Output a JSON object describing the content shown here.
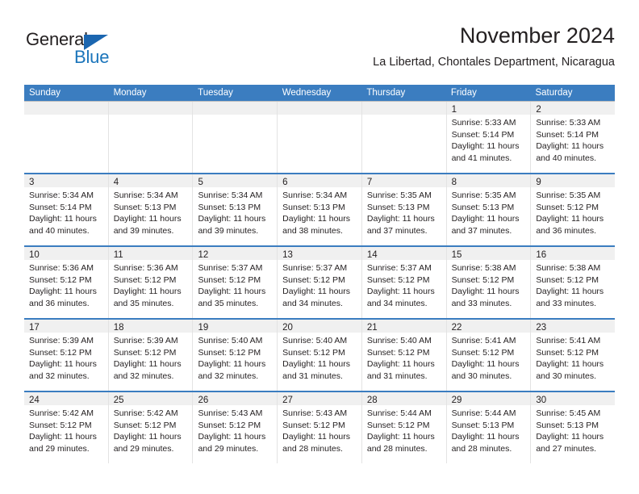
{
  "logo": {
    "word1": "General",
    "word2": "Blue",
    "triangle_color": "#1b66b0",
    "blue_color": "#1b75bb"
  },
  "header": {
    "title": "November 2024",
    "subtitle": "La Libertad, Chontales Department, Nicaragua"
  },
  "theme": {
    "header_blue": "#3b7dc0",
    "daynum_band": "#f0f0f0",
    "text": "#231f20"
  },
  "weekday_headers": [
    "Sunday",
    "Monday",
    "Tuesday",
    "Wednesday",
    "Thursday",
    "Friday",
    "Saturday"
  ],
  "weeks": [
    {
      "days": [
        {
          "num": "",
          "sunrise": "",
          "sunset": "",
          "daylight1": "",
          "daylight2": "",
          "empty": true
        },
        {
          "num": "",
          "sunrise": "",
          "sunset": "",
          "daylight1": "",
          "daylight2": "",
          "empty": true
        },
        {
          "num": "",
          "sunrise": "",
          "sunset": "",
          "daylight1": "",
          "daylight2": "",
          "empty": true
        },
        {
          "num": "",
          "sunrise": "",
          "sunset": "",
          "daylight1": "",
          "daylight2": "",
          "empty": true
        },
        {
          "num": "",
          "sunrise": "",
          "sunset": "",
          "daylight1": "",
          "daylight2": "",
          "empty": true
        },
        {
          "num": "1",
          "sunrise": "Sunrise: 5:33 AM",
          "sunset": "Sunset: 5:14 PM",
          "daylight1": "Daylight: 11 hours",
          "daylight2": "and 41 minutes."
        },
        {
          "num": "2",
          "sunrise": "Sunrise: 5:33 AM",
          "sunset": "Sunset: 5:14 PM",
          "daylight1": "Daylight: 11 hours",
          "daylight2": "and 40 minutes."
        }
      ]
    },
    {
      "days": [
        {
          "num": "3",
          "sunrise": "Sunrise: 5:34 AM",
          "sunset": "Sunset: 5:14 PM",
          "daylight1": "Daylight: 11 hours",
          "daylight2": "and 40 minutes."
        },
        {
          "num": "4",
          "sunrise": "Sunrise: 5:34 AM",
          "sunset": "Sunset: 5:13 PM",
          "daylight1": "Daylight: 11 hours",
          "daylight2": "and 39 minutes."
        },
        {
          "num": "5",
          "sunrise": "Sunrise: 5:34 AM",
          "sunset": "Sunset: 5:13 PM",
          "daylight1": "Daylight: 11 hours",
          "daylight2": "and 39 minutes."
        },
        {
          "num": "6",
          "sunrise": "Sunrise: 5:34 AM",
          "sunset": "Sunset: 5:13 PM",
          "daylight1": "Daylight: 11 hours",
          "daylight2": "and 38 minutes."
        },
        {
          "num": "7",
          "sunrise": "Sunrise: 5:35 AM",
          "sunset": "Sunset: 5:13 PM",
          "daylight1": "Daylight: 11 hours",
          "daylight2": "and 37 minutes."
        },
        {
          "num": "8",
          "sunrise": "Sunrise: 5:35 AM",
          "sunset": "Sunset: 5:13 PM",
          "daylight1": "Daylight: 11 hours",
          "daylight2": "and 37 minutes."
        },
        {
          "num": "9",
          "sunrise": "Sunrise: 5:35 AM",
          "sunset": "Sunset: 5:12 PM",
          "daylight1": "Daylight: 11 hours",
          "daylight2": "and 36 minutes."
        }
      ]
    },
    {
      "days": [
        {
          "num": "10",
          "sunrise": "Sunrise: 5:36 AM",
          "sunset": "Sunset: 5:12 PM",
          "daylight1": "Daylight: 11 hours",
          "daylight2": "and 36 minutes."
        },
        {
          "num": "11",
          "sunrise": "Sunrise: 5:36 AM",
          "sunset": "Sunset: 5:12 PM",
          "daylight1": "Daylight: 11 hours",
          "daylight2": "and 35 minutes."
        },
        {
          "num": "12",
          "sunrise": "Sunrise: 5:37 AM",
          "sunset": "Sunset: 5:12 PM",
          "daylight1": "Daylight: 11 hours",
          "daylight2": "and 35 minutes."
        },
        {
          "num": "13",
          "sunrise": "Sunrise: 5:37 AM",
          "sunset": "Sunset: 5:12 PM",
          "daylight1": "Daylight: 11 hours",
          "daylight2": "and 34 minutes."
        },
        {
          "num": "14",
          "sunrise": "Sunrise: 5:37 AM",
          "sunset": "Sunset: 5:12 PM",
          "daylight1": "Daylight: 11 hours",
          "daylight2": "and 34 minutes."
        },
        {
          "num": "15",
          "sunrise": "Sunrise: 5:38 AM",
          "sunset": "Sunset: 5:12 PM",
          "daylight1": "Daylight: 11 hours",
          "daylight2": "and 33 minutes."
        },
        {
          "num": "16",
          "sunrise": "Sunrise: 5:38 AM",
          "sunset": "Sunset: 5:12 PM",
          "daylight1": "Daylight: 11 hours",
          "daylight2": "and 33 minutes."
        }
      ]
    },
    {
      "days": [
        {
          "num": "17",
          "sunrise": "Sunrise: 5:39 AM",
          "sunset": "Sunset: 5:12 PM",
          "daylight1": "Daylight: 11 hours",
          "daylight2": "and 32 minutes."
        },
        {
          "num": "18",
          "sunrise": "Sunrise: 5:39 AM",
          "sunset": "Sunset: 5:12 PM",
          "daylight1": "Daylight: 11 hours",
          "daylight2": "and 32 minutes."
        },
        {
          "num": "19",
          "sunrise": "Sunrise: 5:40 AM",
          "sunset": "Sunset: 5:12 PM",
          "daylight1": "Daylight: 11 hours",
          "daylight2": "and 32 minutes."
        },
        {
          "num": "20",
          "sunrise": "Sunrise: 5:40 AM",
          "sunset": "Sunset: 5:12 PM",
          "daylight1": "Daylight: 11 hours",
          "daylight2": "and 31 minutes."
        },
        {
          "num": "21",
          "sunrise": "Sunrise: 5:40 AM",
          "sunset": "Sunset: 5:12 PM",
          "daylight1": "Daylight: 11 hours",
          "daylight2": "and 31 minutes."
        },
        {
          "num": "22",
          "sunrise": "Sunrise: 5:41 AM",
          "sunset": "Sunset: 5:12 PM",
          "daylight1": "Daylight: 11 hours",
          "daylight2": "and 30 minutes."
        },
        {
          "num": "23",
          "sunrise": "Sunrise: 5:41 AM",
          "sunset": "Sunset: 5:12 PM",
          "daylight1": "Daylight: 11 hours",
          "daylight2": "and 30 minutes."
        }
      ]
    },
    {
      "days": [
        {
          "num": "24",
          "sunrise": "Sunrise: 5:42 AM",
          "sunset": "Sunset: 5:12 PM",
          "daylight1": "Daylight: 11 hours",
          "daylight2": "and 29 minutes."
        },
        {
          "num": "25",
          "sunrise": "Sunrise: 5:42 AM",
          "sunset": "Sunset: 5:12 PM",
          "daylight1": "Daylight: 11 hours",
          "daylight2": "and 29 minutes."
        },
        {
          "num": "26",
          "sunrise": "Sunrise: 5:43 AM",
          "sunset": "Sunset: 5:12 PM",
          "daylight1": "Daylight: 11 hours",
          "daylight2": "and 29 minutes."
        },
        {
          "num": "27",
          "sunrise": "Sunrise: 5:43 AM",
          "sunset": "Sunset: 5:12 PM",
          "daylight1": "Daylight: 11 hours",
          "daylight2": "and 28 minutes."
        },
        {
          "num": "28",
          "sunrise": "Sunrise: 5:44 AM",
          "sunset": "Sunset: 5:12 PM",
          "daylight1": "Daylight: 11 hours",
          "daylight2": "and 28 minutes."
        },
        {
          "num": "29",
          "sunrise": "Sunrise: 5:44 AM",
          "sunset": "Sunset: 5:13 PM",
          "daylight1": "Daylight: 11 hours",
          "daylight2": "and 28 minutes."
        },
        {
          "num": "30",
          "sunrise": "Sunrise: 5:45 AM",
          "sunset": "Sunset: 5:13 PM",
          "daylight1": "Daylight: 11 hours",
          "daylight2": "and 27 minutes."
        }
      ]
    }
  ]
}
